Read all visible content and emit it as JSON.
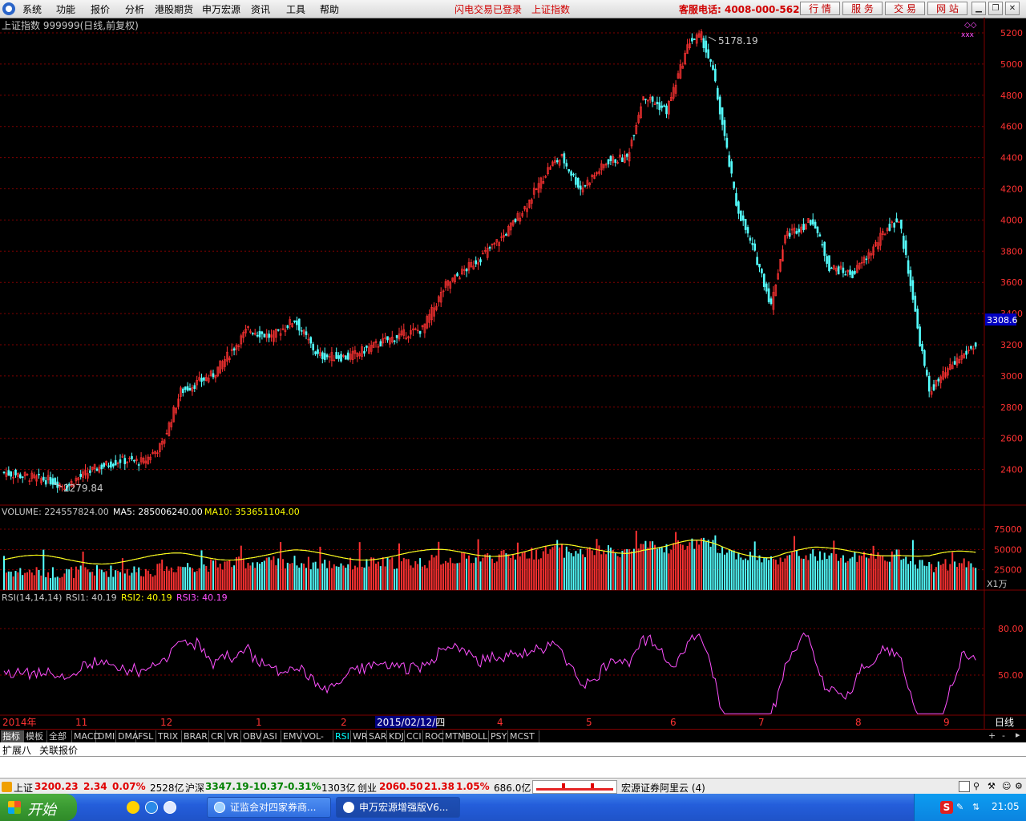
{
  "menu": {
    "items": [
      "系统",
      "功能",
      "报价",
      "分析",
      "港股期货",
      "申万宏源",
      "资讯",
      "工具",
      "帮助"
    ],
    "login_status": "闪电交易已登录",
    "current_index": "上证指数",
    "hotline": "客服电话: 4008-000-562",
    "service_buttons": [
      "行 情",
      "服 务",
      "交 易",
      "网 站"
    ]
  },
  "chart": {
    "header": "上证指数 999999(日线,前复权)",
    "max_label": "5178.19",
    "min_label": "2279.84",
    "current_price_tag": "3308.6",
    "price_ticks": [
      "5200",
      "5000",
      "4800",
      "4600",
      "4400",
      "4200",
      "4000",
      "3800",
      "3600",
      "3400",
      "3200",
      "3000",
      "2800",
      "2600",
      "2400"
    ],
    "volume_header": {
      "volume": "VOLUME: 224557824.00",
      "ma5": "MA5: 285006240.00",
      "ma10": "MA10: 353651104.00"
    },
    "volume_ticks": [
      "75000",
      "50000",
      "25000"
    ],
    "volume_unit": "X1万",
    "rsi_header": {
      "label": "RSI(14,14,14)",
      "rsi1": "RSI1: 40.19",
      "rsi2": "RSI2: 40.19",
      "rsi3": "RSI3: 40.19"
    },
    "rsi_ticks": [
      "80.00",
      "50.00"
    ],
    "date_labels": [
      "2014年",
      "11",
      "12",
      "1",
      "2",
      "4",
      "5",
      "6",
      "7",
      "8",
      "9"
    ],
    "cursor_date": "2015/02/12/四",
    "period": "日线",
    "colors": {
      "up": "#ff3232",
      "down": "#54ffff",
      "grid": "#800000",
      "rsi": "#ff50ff",
      "ma5": "#ffffff",
      "ma10": "#ffff00"
    }
  },
  "indicator_tabs": [
    "指标",
    "模板",
    "全部",
    "MACD",
    "DMI",
    "DMA",
    "FSL",
    "TRIX",
    "BRAR",
    "CR",
    "VR",
    "OBV",
    "ASI",
    "EMV",
    "VOL-TDX",
    "RSI",
    "WR",
    "SAR",
    "KDJ",
    "CCI",
    "ROC",
    "MTM",
    "BOLL",
    "PSY",
    "MCST"
  ],
  "active_tab": "RSI",
  "sub_tabs": [
    "扩展八",
    "关联报价"
  ],
  "status_bar": {
    "sh_label": "上证",
    "sh_price": "3200.23",
    "sh_change": "2.34",
    "sh_pct": "0.07%",
    "sh_amount": "2528亿",
    "hs_label": "沪深",
    "hs_price": "3347.19",
    "hs_change": "-10.37",
    "hs_pct": "-0.31%",
    "hs_amount": "1303亿",
    "cy_label": "创业",
    "cy_price": "2060.50",
    "cy_change": "21.38",
    "cy_pct": "1.05%",
    "cy_amount": "686.0亿",
    "broker": "宏源证券阿里云 (4)"
  },
  "taskbar": {
    "start": "开始",
    "tasks": [
      "证监会对四家券商...",
      "申万宏源增强版V6..."
    ],
    "clock": "21:05"
  }
}
